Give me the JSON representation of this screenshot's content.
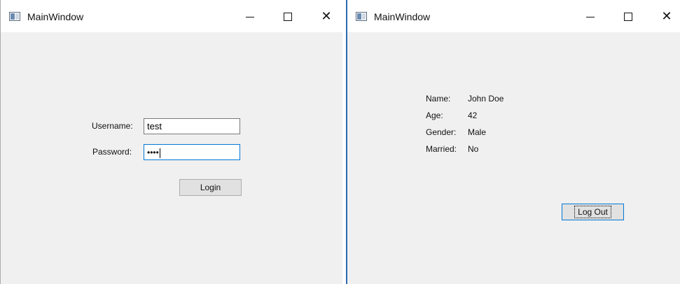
{
  "left_window": {
    "title": "MainWindow",
    "username_label": "Username:",
    "username_value": "test",
    "password_label": "Password:",
    "password_value": "••••",
    "login_label": "Login"
  },
  "right_window": {
    "title": "MainWindow",
    "profile": [
      {
        "label": "Name:",
        "value": "John Doe"
      },
      {
        "label": "Age:",
        "value": "42"
      },
      {
        "label": "Gender:",
        "value": "Male"
      },
      {
        "label": "Married:",
        "value": "No"
      }
    ],
    "logout_label": "Log Out"
  },
  "titlebar_buttons": {
    "minimize_icon": "minimize-icon",
    "maximize_icon": "maximize-icon",
    "close_icon": "close-icon"
  },
  "colors": {
    "window_bg": "#f0f0f0",
    "titlebar_bg": "#ffffff",
    "focus_accent": "#0078d7",
    "divider": "#2b6cb0"
  }
}
